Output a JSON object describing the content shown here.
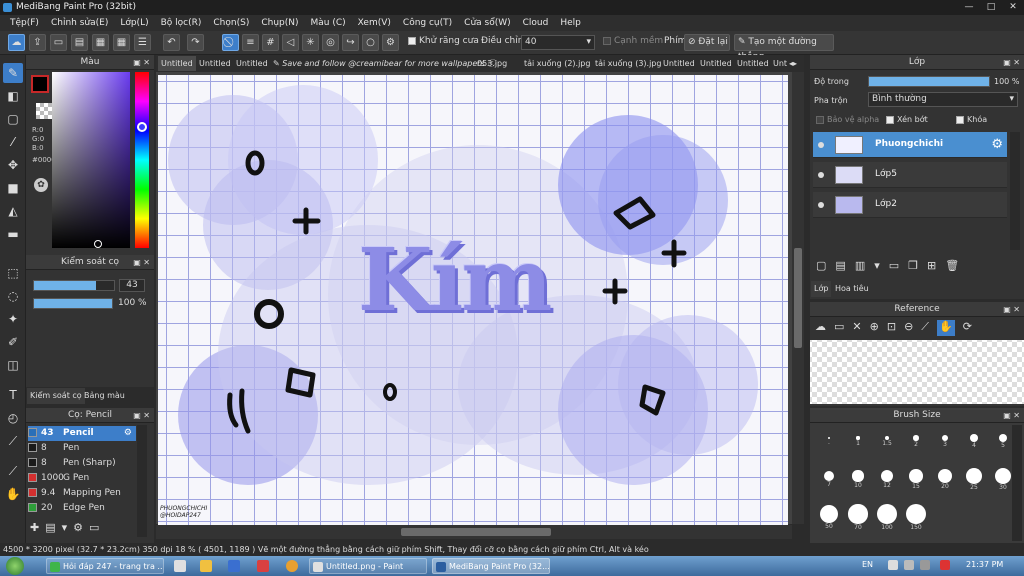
{
  "window": {
    "title": "MediBang Paint Pro (32bit)",
    "controls": [
      "—",
      "□",
      "✕"
    ]
  },
  "menu": [
    "Tệp(F)",
    "Chỉnh sửa(E)",
    "Lớp(L)",
    "Bộ lọc(R)",
    "Chọn(S)",
    "Chụp(N)",
    "Màu (C)",
    "Xem(V)",
    "Công cụ(T)",
    "Cửa sổ(W)",
    "Cloud",
    "Help"
  ],
  "toolbar": {
    "antialias_label": "Khử răng cưa",
    "adjust_label": "Điều chỉnh",
    "adjust_value": "40",
    "sharpen_label": "Cạnh mềm",
    "key_label": "Phím",
    "reset_label": "Đặt lại",
    "straight_line_label": "Tạo một đường thẳng"
  },
  "color_panel": {
    "title": "Màu",
    "r_label": "R:0",
    "g_label": "G:0",
    "b_label": "B:0",
    "hex": "#000000",
    "foreground": "#000000"
  },
  "brush_control": {
    "title": "Kiểm soát cọ",
    "size": "43",
    "opacity": "100 %",
    "size_fraction": 0.78,
    "opacity_fraction": 1.0,
    "tabs": [
      "Kiểm soát cọ",
      "Bảng màu"
    ]
  },
  "brush_list": {
    "title": "Cọ: Pencil",
    "items": [
      {
        "size": "43",
        "name": "Pencil",
        "color": "#2a6fb8",
        "selected": true
      },
      {
        "size": "8",
        "name": "Pen",
        "color": "#1a1a1a"
      },
      {
        "size": "8",
        "name": "Pen (Sharp)",
        "color": "#1a1a1a"
      },
      {
        "size": "1000",
        "name": "G Pen",
        "color": "#d32f2f"
      },
      {
        "size": "9.4",
        "name": "Mapping Pen",
        "color": "#d32f2f"
      },
      {
        "size": "20",
        "name": "Edge Pen",
        "color": "#2e9e3a"
      }
    ]
  },
  "tabs": [
    "Untitled",
    "Untitled",
    "Untitled",
    "Save and follow @creamibear for more wallpapers",
    "053.jpg",
    "tải xuống (2).jpg",
    "tải xuống (3).jpg",
    "Untitled",
    "Untitled",
    "Untitled",
    "Unt"
  ],
  "canvas": {
    "word": "Kím",
    "signature_line1": "PHUONGCHICHI",
    "signature_line2": "@HOIDAP247",
    "accent": "#8f8ee8"
  },
  "layer_panel": {
    "title": "Lớp",
    "opacity_label": "Độ trong",
    "opacity_value": "100 %",
    "opacity_fraction": 1.0,
    "blend_label": "Pha trộn",
    "blend_value": "Bình thường",
    "protect_alpha": "Bảo vệ alpha",
    "clipping": "Xén bớt",
    "lock": "Khóa",
    "layers": [
      {
        "name": "Phuongchichi",
        "selected": true
      },
      {
        "name": "Lớp5"
      },
      {
        "name": "Lớp2"
      }
    ],
    "tabs": [
      "Lớp",
      "Hoa tiêu"
    ]
  },
  "reference_panel": {
    "title": "Reference"
  },
  "brush_size_panel": {
    "title": "Brush Size",
    "labels": [
      ".",
      "1",
      "1.5",
      "2",
      "3",
      "4",
      "5",
      "7",
      "10",
      "12",
      "15",
      "20",
      "25",
      "30",
      "50",
      "70",
      "100",
      "150"
    ]
  },
  "status": {
    "size": "4500 * 3200 pixel",
    "physical": "(32.7 * 23.2cm)",
    "dpi": "350 dpi",
    "zoom": "18 %",
    "cursor": "( 4501, 1189 )",
    "hint": "Vẽ một đường thẳng bằng cách giữ phím Shift, Thay đổi cỡ cọ bằng cách giữ phím Ctrl, Alt và kéo"
  },
  "taskbar": {
    "tasks": [
      "Hỏi đáp 247 - trang tra ...",
      "Untitled.png - Paint",
      "MediBang Paint Pro (32..."
    ],
    "lang": "EN",
    "time": "21:37 PM"
  }
}
